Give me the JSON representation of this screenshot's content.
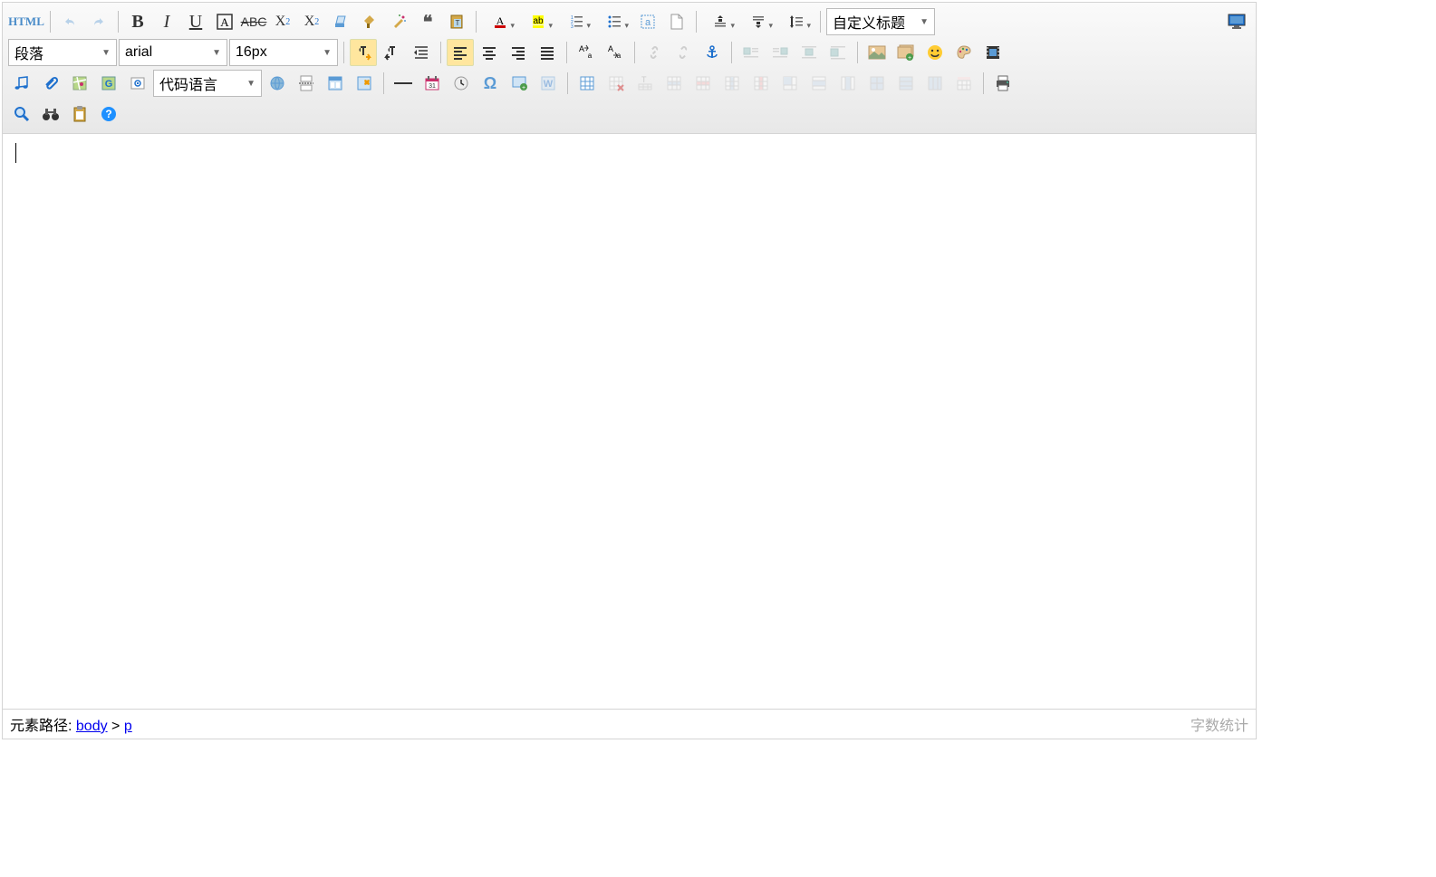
{
  "toolbar": {
    "html_label": "HTML",
    "paragraph_select": "段落",
    "font_select": "arial",
    "size_select": "16px",
    "code_lang_select": "代码语言",
    "custom_heading_select": "自定义标题"
  },
  "statusbar": {
    "path_label": "元素路径: ",
    "path_body": "body",
    "path_sep": " > ",
    "path_p": "p",
    "wordcount_label": "字数统计"
  },
  "icons": {
    "bold": "B",
    "italic": "I",
    "underline": "U",
    "quote": "❝❝",
    "sup": "X",
    "sub": "X"
  }
}
